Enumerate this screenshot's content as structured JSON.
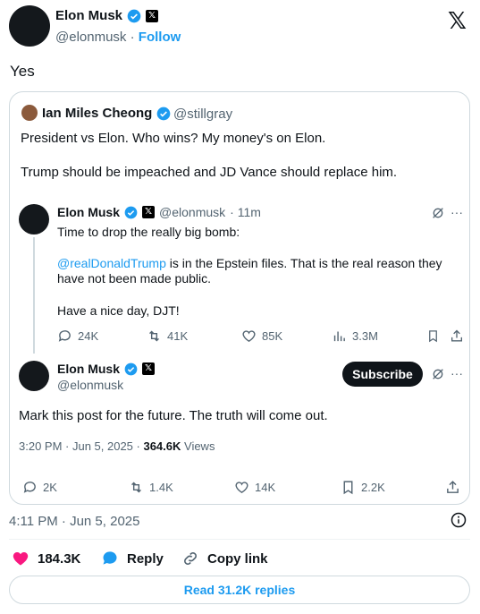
{
  "author": {
    "name": "Elon Musk",
    "handle": "@elonmusk",
    "separator": "·",
    "follow": "Follow"
  },
  "tweet": {
    "text": "Yes"
  },
  "quote": {
    "name": "Ian Miles Cheong",
    "handle": "@stillgray",
    "line1": "President vs Elon. Who wins? My money's on Elon.",
    "line2": "Trump should be impeached and JD Vance should replace him."
  },
  "inner1": {
    "name": "Elon Musk",
    "handle": "@elonmusk",
    "time": "· 11m",
    "text1": "Time to drop the really big bomb:",
    "mention": "@realDonaldTrump",
    "text2": " is in the Epstein files. That is the real reason they have not been made public.",
    "text3": "Have a nice day, DJT!",
    "replies": "24K",
    "retweets": "41K",
    "likes": "85K",
    "views": "3.3M"
  },
  "inner2": {
    "name": "Elon Musk",
    "handle": "@elonmusk",
    "subscribe": "Subscribe",
    "text": "Mark this post for the future. The truth will come out.",
    "time_prefix": "3:20 PM · Jun 5, 2025 · ",
    "views_count": "364.6K",
    "views_label": " Views",
    "replies": "2K",
    "retweets": "1.4K",
    "likes": "14K",
    "bookmarks": "2.2K"
  },
  "timestamp": "4:11 PM · Jun 5, 2025",
  "actions": {
    "likes": "184.3K",
    "reply": "Reply",
    "copy": "Copy link"
  },
  "read_replies": "Read 31.2K replies",
  "colors": {
    "accent": "#1d9bf0",
    "like": "#f91880",
    "text": "#0f1419",
    "muted": "#536471"
  }
}
